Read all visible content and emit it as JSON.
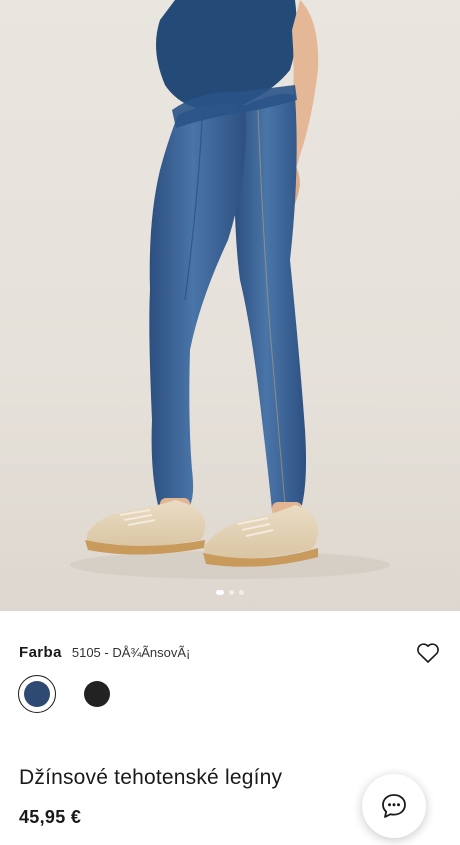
{
  "product": {
    "image_alt": "maternity jeans leggings",
    "gallery": {
      "count": 3,
      "active_index": 0
    },
    "color_label": "Farba",
    "color_value": "5105 - DÅ¾ÃnsovÃ¡",
    "swatches": [
      {
        "name": "denim",
        "hex": "#2f4a72",
        "selected": true
      },
      {
        "name": "black",
        "hex": "#222222",
        "selected": false
      }
    ],
    "title": "Džínsové tehotenské legíny",
    "price": "45,95 €"
  },
  "icons": {
    "wishlist": "heart-outline-icon",
    "chat": "chat-bubble-icon"
  }
}
